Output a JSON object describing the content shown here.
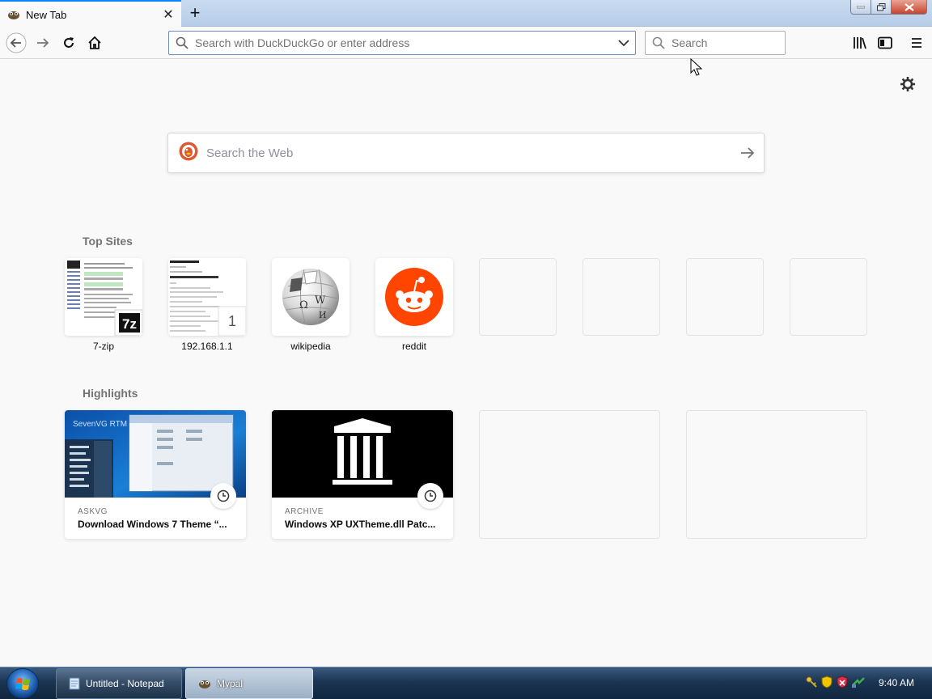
{
  "browser": {
    "tab": {
      "title": "New Tab",
      "close_glyph": "✕"
    },
    "newtab_glyph": "+",
    "address_bar": {
      "placeholder": "Search with DuckDuckGo or enter address"
    },
    "search_bar": {
      "placeholder": "Search"
    }
  },
  "newtab": {
    "web_search": {
      "placeholder": "Search the Web"
    },
    "top_sites_title": "Top Sites",
    "top_sites": [
      {
        "label": "7-zip"
      },
      {
        "label": "192.168.1.1",
        "badge": "1"
      },
      {
        "label": "wikipedia"
      },
      {
        "label": "reddit"
      }
    ],
    "highlights_title": "Highlights",
    "highlights": [
      {
        "source": "ASKVG",
        "title": "Download Windows 7 Theme “...",
        "image_caption": "SevenVG RTM"
      },
      {
        "source": "ARCHIVE",
        "title": "Windows XP UXTheme.dll Patc..."
      }
    ]
  },
  "taskbar": {
    "buttons": [
      {
        "label": "Untitled - Notepad"
      },
      {
        "label": "Mypal"
      }
    ],
    "clock": "9:40 AM"
  },
  "colors": {
    "accent": "#0a84ff",
    "reddit": "#ff4500",
    "duckduckgo": "#de5833"
  }
}
